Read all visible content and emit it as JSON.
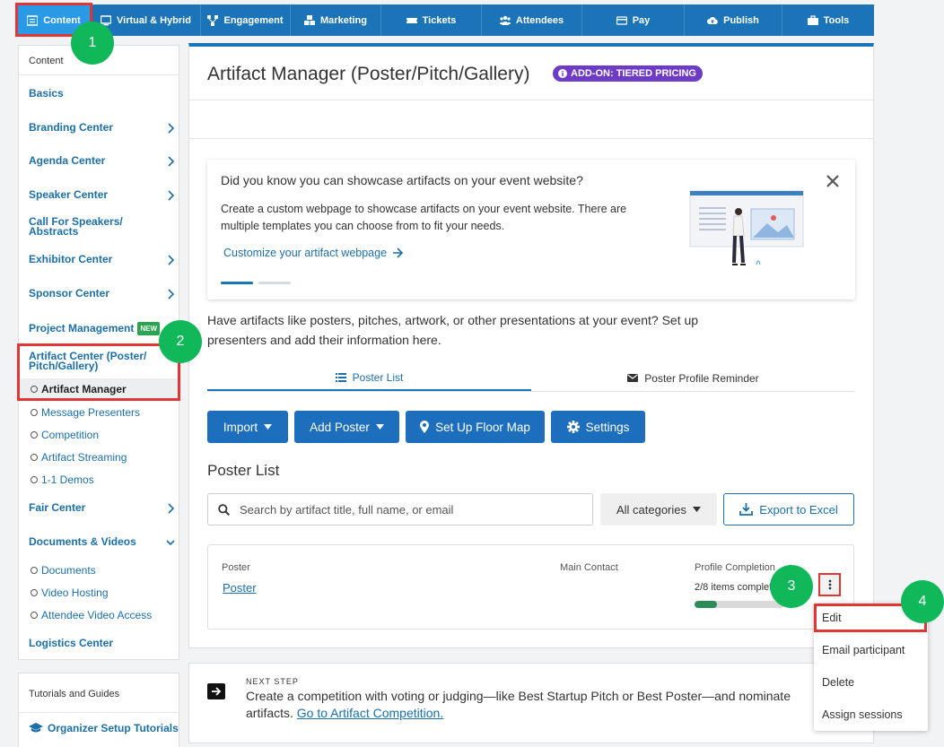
{
  "topnav": {
    "items": [
      {
        "label": "Content",
        "icon": "list-icon"
      },
      {
        "label": "Virtual & Hybrid",
        "icon": "monitor-icon"
      },
      {
        "label": "Engagement",
        "icon": "network-icon"
      },
      {
        "label": "Marketing",
        "icon": "cubes-icon"
      },
      {
        "label": "Tickets",
        "icon": "ticket-icon"
      },
      {
        "label": "Attendees",
        "icon": "users-icon"
      },
      {
        "label": "Pay",
        "icon": "card-icon"
      },
      {
        "label": "Publish",
        "icon": "cloud-upload-icon"
      },
      {
        "label": "Tools",
        "icon": "briefcase-icon"
      }
    ],
    "active": "Content"
  },
  "sidebar": {
    "header": "Content",
    "items": {
      "basics": "Basics",
      "branding": "Branding Center",
      "agenda": "Agenda Center",
      "speaker": "Speaker Center",
      "cfs": "Call For Speakers/ Abstracts",
      "exhibitor": "Exhibitor Center",
      "sponsor": "Sponsor Center",
      "project": "Project Management",
      "project_badge": "NEW",
      "artifact": "Artifact Center (Poster/ Pitch/Gallery)",
      "artifact_manager": "Artifact Manager",
      "message_presenters": "Message Presenters",
      "competition": "Competition",
      "streaming": "Artifact Streaming",
      "demos": "1-1 Demos",
      "fair": "Fair Center",
      "documents_videos": "Documents & Videos",
      "documents": "Documents",
      "video_hosting": "Video Hosting",
      "attendee_video": "Attendee Video Access",
      "logistics": "Logistics Center"
    }
  },
  "tutorials": {
    "header": "Tutorials and Guides",
    "link": "Organizer Setup Tutorials"
  },
  "main": {
    "title": "Artifact Manager (Poster/Pitch/Gallery)",
    "addon": "ADD-ON: TIERED PRICING",
    "promo": {
      "title": "Did you know you can showcase artifacts on your event website?",
      "body": "Create a custom webpage to showcase artifacts on your event website. There are multiple templates you can choose from to fit your needs.",
      "link": "Customize your artifact webpage"
    },
    "intro": "Have artifacts like posters, pitches, artwork, or other presentations at your event? Set up presenters and add their information here.",
    "tabs": [
      "Poster List",
      "Poster Profile Reminder"
    ],
    "buttons": {
      "import": "Import",
      "add_poster": "Add Poster",
      "floor_map": "Set Up Floor Map",
      "settings": "Settings"
    },
    "section_title": "Poster List",
    "search_placeholder": "Search by artifact title, full name, or email",
    "category": "All categories",
    "export": "Export to Excel",
    "table": {
      "col_poster": "Poster",
      "col_contact": "Main Contact",
      "col_completion": "Profile Completion",
      "row_poster": "Poster",
      "row_completion": "2/8 items completed",
      "completion_fraction": 0.25
    }
  },
  "next_step": {
    "label": "NEXT STEP",
    "text": "Create a competition with voting or judging—like Best Startup Pitch or Best Poster—and nominate",
    "text2": "artifacts.",
    "link": "Go to Artifact Competition."
  },
  "menu": {
    "items": [
      "Edit",
      "Email participant",
      "Delete",
      "Assign sessions"
    ]
  },
  "markers": [
    "1",
    "2",
    "3",
    "4"
  ],
  "colors": {
    "nav": "#1b74b8",
    "accent": "#1d6fbd",
    "highlight": "#e23636",
    "marker": "#11b85a",
    "addon": "#6d3bc6"
  }
}
